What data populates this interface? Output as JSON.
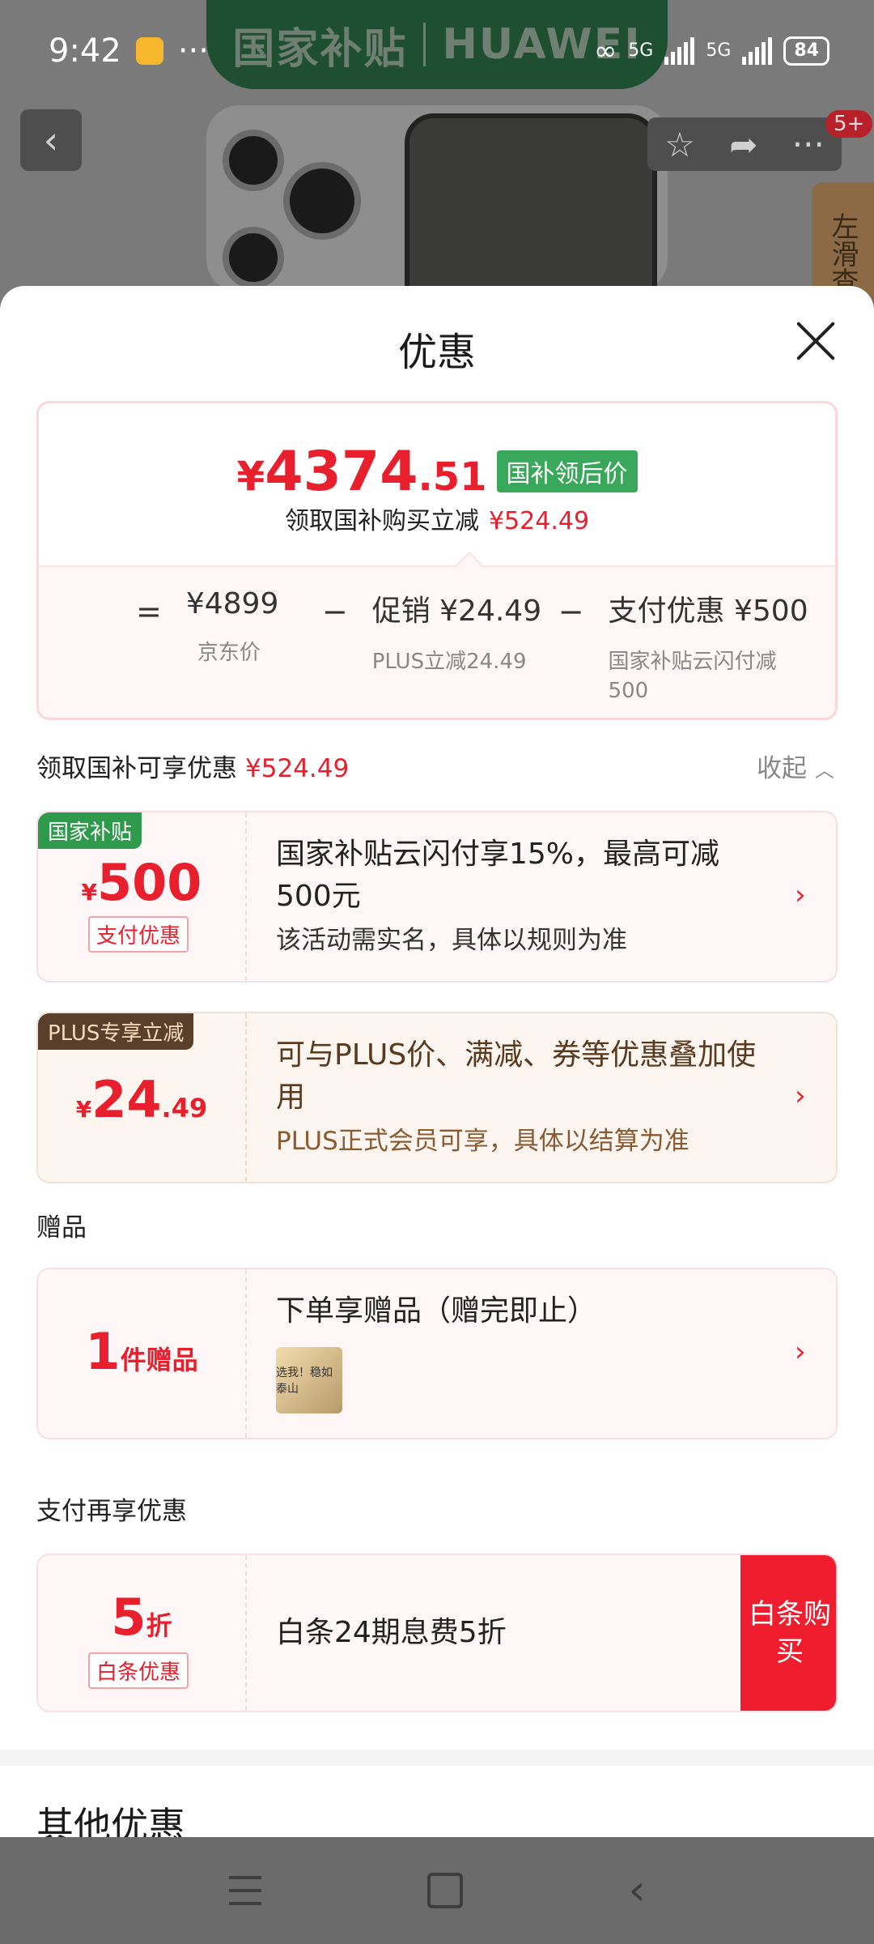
{
  "status_bar": {
    "time": "9:42",
    "more": "···",
    "sig1": "5G",
    "sig2": "5G",
    "battery": "84"
  },
  "background": {
    "banner_left": "国家补贴",
    "banner_right": "HUAWEI",
    "side_tab": "左滑查",
    "badge": "5+"
  },
  "sheet": {
    "title": "优惠",
    "summary": {
      "price_symbol": "¥",
      "price_int": "4374",
      "price_dec": ".51",
      "price_tag": "国补领后价",
      "subsidy_label": "领取国补购买立减",
      "subsidy_amount": "¥524.49",
      "calc": [
        {
          "op": "=",
          "value": "¥4899",
          "sub": "京东价"
        },
        {
          "op": "−",
          "value": "促销 ¥24.49",
          "sub": "PLUS立减24.49"
        },
        {
          "op": "−",
          "value": "支付优惠 ¥500",
          "sub": "国家补贴云闪付减500"
        }
      ]
    },
    "section_subsidy": {
      "label": "领取国补可享优惠",
      "amount": "¥524.49",
      "collapse": "收起"
    },
    "card_subsidy": {
      "corner": "国家补贴",
      "symbol": "¥",
      "amount": "500",
      "tag": "支付优惠",
      "title": "国家补贴云闪付享15%，最高可减500元",
      "desc": "该活动需实名，具体以规则为准"
    },
    "card_plus": {
      "corner": "PLUS专享立减",
      "symbol": "¥",
      "amount": "24",
      "dec": ".49",
      "title": "可与PLUS价、满减、券等优惠叠加使用",
      "desc": "PLUS正式会员可享，具体以结算为准"
    },
    "section_gift": "赠品",
    "card_gift": {
      "count": "1",
      "unit": "件赠品",
      "title": "下单享赠品（赠完即止）",
      "thumb_text": "选我！稳如泰山"
    },
    "section_pay": "支付再享优惠",
    "card_baitiao": {
      "amount": "5",
      "unit": "折",
      "tag": "白条优惠",
      "title": "白条24期息费5折",
      "button": "白条购买"
    },
    "other_title": "其他优惠"
  },
  "colors": {
    "accent": "#e8202e",
    "green_tag": "#3aa85a",
    "plus_brown": "#5a3a1f"
  }
}
